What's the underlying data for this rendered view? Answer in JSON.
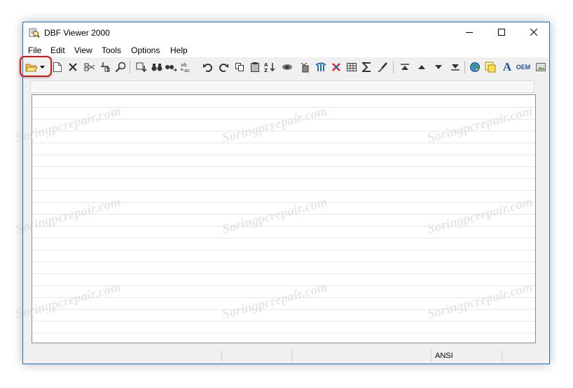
{
  "window": {
    "title": "DBF Viewer 2000"
  },
  "title_controls": {
    "minimize_icon": "minimize-icon",
    "maximize_icon": "maximize-icon",
    "close_icon": "close-icon"
  },
  "menu": [
    "File",
    "Edit",
    "View",
    "Tools",
    "Options",
    "Help"
  ],
  "toolbar": {
    "text_buttons": {
      "font": "A",
      "oem": "OEM"
    },
    "icons": [
      "open-folder-icon",
      "dropdown-arrow-icon",
      "new-file-icon",
      "delete-icon",
      "cut-icon",
      "paste-icon",
      "find-icon",
      "insert-row-icon",
      "find-binoculars-icon",
      "find-next-icon",
      "replace-icon",
      "undo-icon",
      "redo-icon",
      "copy-icon",
      "clipboard-icon",
      "sort-az-icon",
      "filter-icon",
      "clear-icon",
      "bookmark-icon",
      "unpin-icon",
      "grid-icon",
      "sum-icon",
      "brush-icon",
      "first-record-icon",
      "previous-record-icon",
      "next-record-icon",
      "last-record-icon",
      "web-icon",
      "note-icon",
      "font-icon",
      "oem-icon",
      "image-icon"
    ]
  },
  "status_bar": {
    "encoding": "ANSI"
  },
  "watermark": "Soringpcrepair.com",
  "colors": {
    "highlight": "#d11a1a",
    "window_border": "#1d6fd4"
  }
}
